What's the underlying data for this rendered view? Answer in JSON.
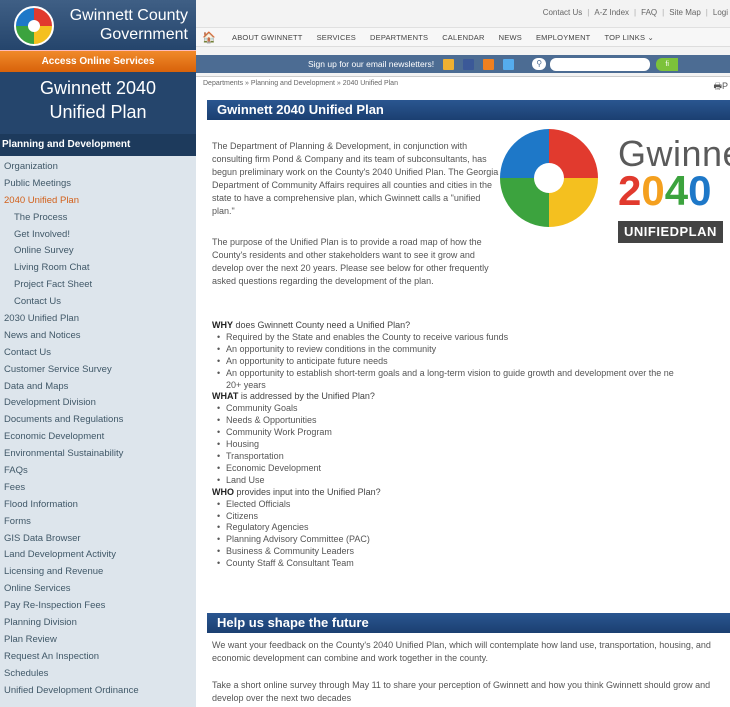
{
  "logo": {
    "line1": "Gwinnett County",
    "line2": "Government"
  },
  "sidebar": {
    "access_label": "Access Online Services",
    "plan_title_1": "Gwinnett 2040",
    "plan_title_2": "Unified Plan",
    "section_heading": "Planning and Development",
    "items": [
      {
        "label": "Organization",
        "level": 0
      },
      {
        "label": "Public Meetings",
        "level": 0
      },
      {
        "label": "2040 Unified Plan",
        "level": 0,
        "active": true
      },
      {
        "label": "The Process",
        "level": 1
      },
      {
        "label": "Get Involved!",
        "level": 1
      },
      {
        "label": "Online Survey",
        "level": 1
      },
      {
        "label": "Living Room Chat",
        "level": 1
      },
      {
        "label": "Project Fact Sheet",
        "level": 1
      },
      {
        "label": "Contact Us",
        "level": 1
      },
      {
        "label": "2030 Unified Plan",
        "level": 0
      },
      {
        "label": "News and Notices",
        "level": 0
      },
      {
        "label": "Contact Us",
        "level": 0
      },
      {
        "label": "Customer Service Survey",
        "level": 0
      },
      {
        "label": "Data and Maps",
        "level": 0
      },
      {
        "label": "Development Division",
        "level": 0
      },
      {
        "label": "Documents and Regulations",
        "level": 0
      },
      {
        "label": "Economic Development",
        "level": 0
      },
      {
        "label": "Environmental Sustainability",
        "level": 0
      },
      {
        "label": "FAQs",
        "level": 0
      },
      {
        "label": "Fees",
        "level": 0
      },
      {
        "label": "Flood Information",
        "level": 0
      },
      {
        "label": "Forms",
        "level": 0
      },
      {
        "label": "GIS Data Browser",
        "level": 0
      },
      {
        "label": "Land Development Activity",
        "level": 0
      },
      {
        "label": "Licensing and Revenue",
        "level": 0
      },
      {
        "label": "Online Services",
        "level": 0
      },
      {
        "label": "Pay Re-Inspection Fees",
        "level": 0
      },
      {
        "label": "Planning Division",
        "level": 0
      },
      {
        "label": "Plan Review",
        "level": 0
      },
      {
        "label": "Request An Inspection",
        "level": 0
      },
      {
        "label": "Schedules",
        "level": 0
      },
      {
        "label": "Unified Development Ordinance",
        "level": 0
      }
    ]
  },
  "header": {
    "util_links": [
      "Contact Us",
      "A-Z Index",
      "FAQ",
      "Site Map",
      "Logi"
    ],
    "nav": [
      "About Gwinnett",
      "Services",
      "Departments",
      "Calendar",
      "News",
      "Employment",
      "Top Links ⌄"
    ],
    "newsletter": "Sign up for our email newsletters!",
    "search_placeholder": "",
    "search_button": "fi"
  },
  "main": {
    "breadcrumb": "Departments » Planning and Development » 2040 Unified Plan",
    "print_label": "P",
    "title": "Gwinnett 2040 Unified Plan",
    "intro_1": "The Department of Planning & Development, in conjunction with consulting firm Pond & Company and its team of subconsultants, has begun preliminary work on the County's 2040 Unified Plan. The Georgia Department of Community Affairs requires all counties and cities in the state to have a comprehensive plan, which Gwinnett calls a \"unified plan.\"",
    "intro_2": "The purpose of the Unified Plan is to provide a road map of how the County's residents and other stakeholders want to see it grow and develop over the next 20 years.  Please see below for other frequently asked questions regarding the development of the plan.",
    "biglogo": {
      "word": "Gwinnet",
      "year": [
        "2",
        "0",
        "4",
        "0"
      ],
      "unified": "UNIFIEDPLAN"
    },
    "why_q": {
      "lead": "WHY",
      "rest": " does Gwinnett County need a Unified Plan?"
    },
    "why_items": [
      "Required by the State and enables the County to receive various funds",
      "An opportunity to review conditions in the community",
      "An opportunity to anticipate future needs",
      "An opportunity to establish short-term goals and a long-term vision to guide growth and development over the ne",
      "20+ years"
    ],
    "what_q": {
      "lead": "WHAT",
      "rest": " is addressed by the Unified Plan?"
    },
    "what_items": [
      "Community Goals",
      "Needs & Opportunities",
      "Community Work Program",
      "Housing",
      "Transportation",
      "Economic Development",
      "Land Use"
    ],
    "who_q": {
      "lead": "WHO",
      "rest": " provides input into the Unified Plan?"
    },
    "who_items": [
      "Elected Officials",
      "Citizens",
      "Regulatory Agencies",
      "Planning Advisory Committee (PAC)",
      "Business & Community Leaders",
      "County Staff & Consultant Team"
    ],
    "title_2": "Help us shape the future",
    "foot_1": "We want your feedback on the County's 2040 Unified Plan, which will contemplate how land use, transportation, housing, and economic development can combine and work together in the county.",
    "foot_2": "Take a short online survey through May 11 to share your perception of Gwinnett and how you think Gwinnett should grow and develop over the next two decades"
  },
  "colors": {
    "accent_orange": "#d8620a",
    "navy": "#25456c",
    "title_blue": "#1b3f71",
    "year_colors": [
      "#e13a2e",
      "#f4a01f",
      "#3ca33e",
      "#1e78c8"
    ]
  }
}
